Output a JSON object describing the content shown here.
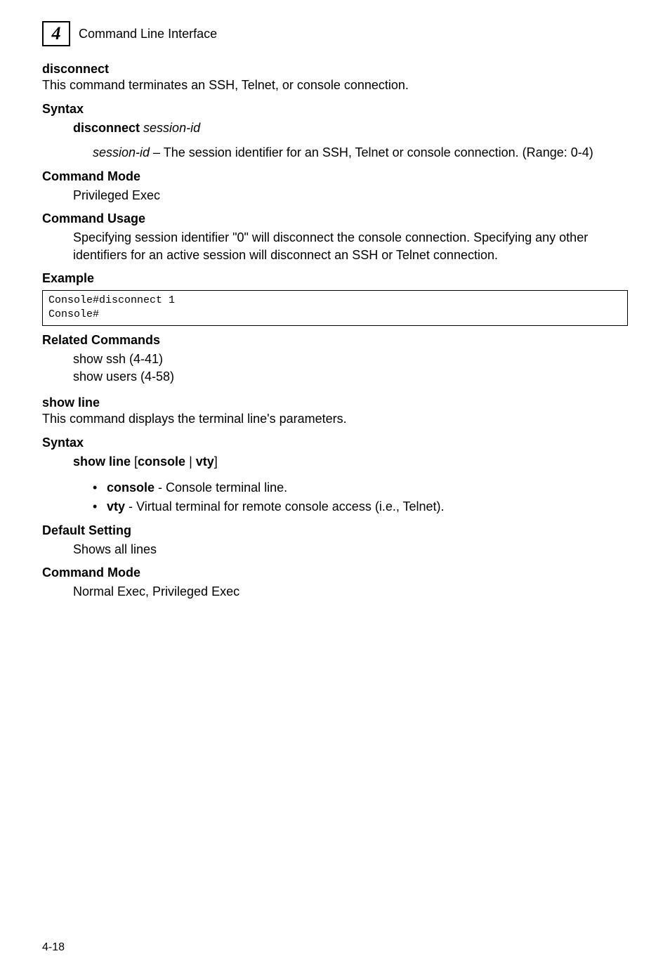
{
  "header": {
    "chapter": "4",
    "title": "Command Line Interface"
  },
  "disconnect": {
    "title": "disconnect",
    "description": "This command terminates an SSH, Telnet, or console connection.",
    "syntax_heading": "Syntax",
    "syntax_cmd_bold": "disconnect",
    "syntax_cmd_italic": "session-id",
    "param_label": "session-id",
    "param_text": " – The session identifier for an SSH, Telnet or console connection. (Range: 0-4)",
    "mode_heading": "Command Mode",
    "mode_text": "Privileged Exec",
    "usage_heading": "Command Usage",
    "usage_text": "Specifying session identifier \"0\" will disconnect the console connection. Specifying any other identifiers for an active session will disconnect an SSH or Telnet connection.",
    "example_heading": "Example",
    "example_code": "Console#disconnect 1\nConsole#",
    "related_heading": "Related Commands",
    "related1": "show ssh (4-41)",
    "related2": "show users (4-58)"
  },
  "showline": {
    "title": "show line",
    "description": "This command displays the terminal line's parameters.",
    "syntax_heading": "Syntax",
    "syntax_bold1": "show line",
    "syntax_plain1": " [",
    "syntax_bold2": "console",
    "syntax_plain2": " | ",
    "syntax_bold3": "vty",
    "syntax_plain3": "]",
    "opt1_bold": "console",
    "opt1_text": " - Console terminal line.",
    "opt2_bold": "vty",
    "opt2_text": " - Virtual terminal for remote console access (i.e., Telnet).",
    "default_heading": "Default Setting",
    "default_text": "Shows all lines",
    "mode_heading": "Command Mode",
    "mode_text": "Normal Exec, Privileged Exec"
  },
  "footer": {
    "page": "4-18"
  }
}
